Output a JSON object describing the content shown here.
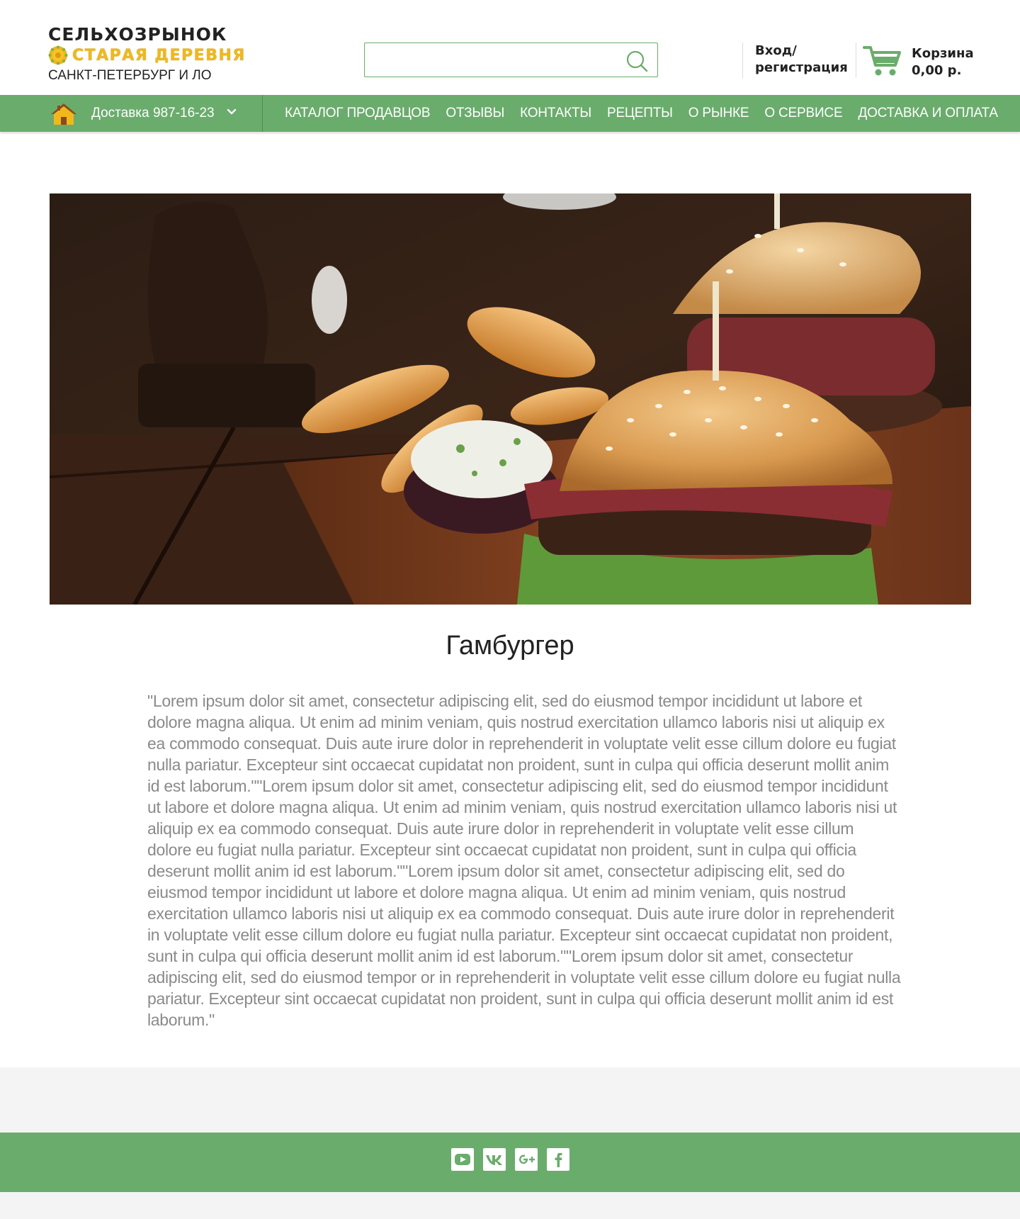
{
  "header": {
    "logo_line1": "СЕЛЬХОЗРЫНОК",
    "logo_line2": "СТАРАЯ ДЕРЕВНЯ",
    "logo_line3": "САНКТ-ПЕТЕРБУРГ И ЛО",
    "search_placeholder": "",
    "login_line1": "Вход/",
    "login_line2": "регистрация",
    "cart_label": "Корзина",
    "cart_total": "0,00 р."
  },
  "nav": {
    "delivery_label": "Доставка",
    "delivery_phone": "987-16-23",
    "links": [
      "КАТАЛОГ ПРОДАВЦОВ",
      "ОТЗЫВЫ",
      "КОНТАКТЫ",
      "РЕЦЕПТЫ",
      "О РЫНКЕ",
      "О СЕРВИСЕ",
      "ДОСТАВКА И ОПЛАТА"
    ]
  },
  "recipe": {
    "title": "Гамбургер",
    "text": "\"Lorem ipsum dolor sit amet, consectetur adipiscing elit, sed do eiusmod tempor incididunt ut labore et dolore magna aliqua. Ut enim ad minim veniam, quis nostrud exercitation ullamco laboris nisi ut aliquip ex ea commodo consequat. Duis aute irure dolor in reprehenderit in voluptate velit esse cillum dolore eu fugiat nulla pariatur. Excepteur sint occaecat cupidatat non proident, sunt in culpa qui officia deserunt mollit anim id est laborum.\"\"Lorem ipsum dolor sit amet, consectetur adipiscing elit, sed do eiusmod tempor incididunt ut labore et dolore magna aliqua. Ut enim ad minim veniam, quis nostrud exercitation ullamco laboris nisi ut aliquip ex ea commodo consequat. Duis aute irure dolor in reprehenderit in voluptate velit esse cillum dolore eu fugiat nulla pariatur. Excepteur sint occaecat cupidatat non proident, sunt in culpa qui officia deserunt mollit anim id est laborum.\"\"Lorem ipsum dolor sit amet, consectetur adipiscing elit, sed do eiusmod tempor incididunt ut labore et dolore magna aliqua. Ut enim ad minim veniam, quis nostrud exercitation ullamco laboris nisi ut aliquip ex ea commodo consequat. Duis aute irure dolor in reprehenderit in voluptate velit esse cillum dolore eu fugiat nulla pariatur. Excepteur sint occaecat cupidatat non proident, sunt in culpa qui officia deserunt mollit anim id est laborum.\"\"Lorem ipsum dolor sit amet, consectetur adipiscing elit, sed do eiusmod tempor or in reprehenderit in voluptate velit esse cillum dolore eu fugiat nulla pariatur. Excepteur sint occaecat cupidatat non proident, sunt in culpa qui officia deserunt mollit anim id est laborum.\""
  },
  "footer": {
    "socials": [
      "youtube-icon",
      "vk-icon",
      "google-plus-icon",
      "facebook-icon"
    ]
  },
  "colors": {
    "accent_green": "#6aac6c",
    "logo_yellow": "#f0b81c",
    "text_grey": "#8a8a8a"
  }
}
